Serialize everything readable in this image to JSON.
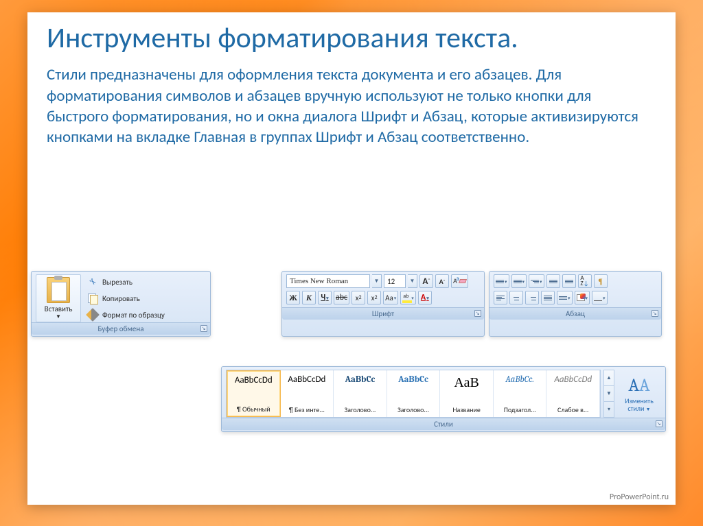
{
  "slide": {
    "title": "Инструменты форматирования текста.",
    "body": "Стили предназначены для оформления текста документа и его абзацев. Для форматирования символов и абзацев вручную используют не только кнопки для быстрого форматирования, но и окна диалога Шрифт и Абзац, которые активизируются кнопками на вкладке Главная в группах Шрифт и Абзац соответственно.",
    "footer": "ProPowerPoint.ru"
  },
  "clipboard": {
    "group_label": "Буфер обмена",
    "paste": "Вставить",
    "cut": "Вырезать",
    "copy": "Копировать",
    "format_painter": "Формат по образцу"
  },
  "font": {
    "group_label": "Шрифт",
    "font_name": "Times New Roman",
    "font_size": "12",
    "bold": "Ж",
    "italic": "К",
    "underline": "Ч",
    "strike": "abc",
    "grow": "A",
    "shrink": "A",
    "case": "Aa",
    "color_letter": "A"
  },
  "para": {
    "group_label": "Абзац",
    "pilcrow": "¶"
  },
  "styles": {
    "group_label": "Стили",
    "change": "Изменить стили",
    "items": [
      {
        "preview": "AaBbCcDd",
        "name": "¶ Обычный",
        "css": "font-family:Calibri;color:#000"
      },
      {
        "preview": "AaBbCcDd",
        "name": "¶ Без инте...",
        "css": "font-family:Calibri;color:#000"
      },
      {
        "preview": "AaBbCc",
        "name": "Заголово...",
        "css": "font-family:Cambria,Georgia,serif;color:#1f4e79;font-weight:bold"
      },
      {
        "preview": "AaBbCc",
        "name": "Заголово...",
        "css": "font-family:Cambria,Georgia,serif;color:#2e74b5;font-weight:bold"
      },
      {
        "preview": "АаВ",
        "name": "Название",
        "css": "font-family:Cambria,Georgia,serif;color:#000;font-size:20px"
      },
      {
        "preview": "AaBbCc.",
        "name": "Подзагол...",
        "css": "font-family:Cambria,Georgia,serif;color:#2e74b5;font-style:italic"
      },
      {
        "preview": "AaBbCcDd",
        "name": "Слабое в...",
        "css": "font-family:Calibri;color:#7a7a7a;font-style:italic"
      }
    ]
  }
}
